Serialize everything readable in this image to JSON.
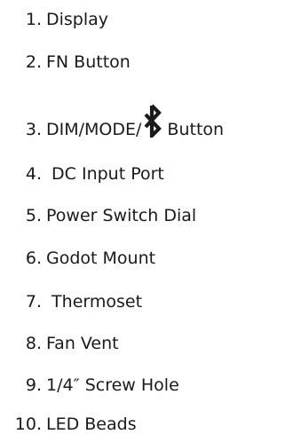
{
  "items": [
    {
      "number": "1.",
      "label": "Display"
    },
    {
      "number": "2.",
      "label": "FN Button"
    },
    {
      "number": "3.",
      "label_before": "DIM/MODE/",
      "label_after": "Button",
      "icon": "bluetooth-icon"
    },
    {
      "number": "4.",
      "label": " DC Input Port"
    },
    {
      "number": "5.",
      "label": "Power Switch Dial"
    },
    {
      "number": "6.",
      "label": "Godot Mount"
    },
    {
      "number": "7.",
      "label": " Thermoset"
    },
    {
      "number": "8.",
      "label": "Fan Vent"
    },
    {
      "number": "9.",
      "label": "1/4″ Screw Hole"
    },
    {
      "number": "10.",
      "label": "LED Beads"
    }
  ]
}
